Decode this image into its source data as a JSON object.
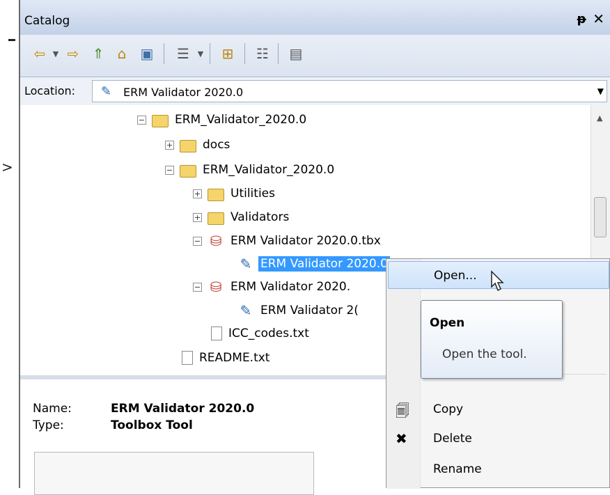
{
  "window": {
    "title": "Catalog",
    "pin_glyph": "ᵽ",
    "close_glyph": "✕"
  },
  "toolbar": {
    "buttons": [
      {
        "name": "back-button",
        "icon": "back-arrow-icon",
        "glyph": "⇦"
      },
      {
        "name": "back-dropdown",
        "icon": "dropdown-icon",
        "glyph": "▼"
      },
      {
        "name": "forward-button",
        "icon": "forward-arrow-icon",
        "glyph": "⇨"
      },
      {
        "name": "up-level-button",
        "icon": "up-folder-icon",
        "glyph": "⇑"
      },
      {
        "name": "home-button",
        "icon": "home-icon",
        "glyph": "⌂"
      },
      {
        "name": "connect-button",
        "icon": "connect-folder-icon",
        "glyph": "▣"
      },
      {
        "name": "view-button",
        "icon": "view-details-icon",
        "glyph": "☰"
      },
      {
        "name": "view-dropdown",
        "icon": "dropdown-icon",
        "glyph": "▼"
      },
      {
        "name": "new-folder-button",
        "icon": "new-folder-icon",
        "glyph": "⊞"
      },
      {
        "name": "tree-view-button",
        "icon": "tree-view-icon",
        "glyph": "☷"
      },
      {
        "name": "options-button",
        "icon": "list-options-icon",
        "glyph": "▤"
      }
    ]
  },
  "location": {
    "label": "Location:",
    "value": "ERM Validator 2020.0",
    "dropdown_glyph": "▼",
    "icon_glyph": "✎"
  },
  "tree": {
    "expand_glyph": "⊞",
    "collapse_glyph": "⊟",
    "nodes": [
      {
        "label": "ERM_Validator_2020.0",
        "type": "folder",
        "expander": "−"
      },
      {
        "label": "docs",
        "type": "folder",
        "expander": "+"
      },
      {
        "label": "ERM_Validator_2020.0",
        "type": "folder",
        "expander": "−"
      },
      {
        "label": "Utilities",
        "type": "folder",
        "expander": "+"
      },
      {
        "label": "Validators",
        "type": "folder",
        "expander": "+"
      },
      {
        "label": "ERM Validator 2020.0.tbx",
        "type": "toolbox",
        "expander": "−"
      },
      {
        "label": "ERM Validator 2020.0",
        "type": "tool",
        "expander": "",
        "selected": true
      },
      {
        "label": "ERM Validator 2020.",
        "type": "toolbox",
        "expander": "−"
      },
      {
        "label": "ERM Validator 2(",
        "type": "tool",
        "expander": ""
      },
      {
        "label": "ICC_codes.txt",
        "type": "text",
        "expander": ""
      },
      {
        "label": "README.txt",
        "type": "text",
        "expander": ""
      }
    ]
  },
  "details": {
    "name_key": "Name:",
    "name_value": "ERM Validator 2020.0",
    "type_key": "Type:",
    "type_value": "Toolbox Tool"
  },
  "context_menu": {
    "items": [
      {
        "label": "Open...",
        "icon": "",
        "highlighted": true
      },
      {
        "label": "Copy",
        "icon": "copy-icon",
        "glyph": "🗐"
      },
      {
        "label": "Delete",
        "icon": "delete-icon",
        "glyph": "✖"
      },
      {
        "label": "Rename",
        "icon": ""
      }
    ]
  },
  "tooltip": {
    "title": "Open",
    "body": "Open the tool."
  },
  "colors": {
    "selection": "#3399ff",
    "title_bar": "#c3d2e8",
    "menu_highlight": "#cfe3fb"
  }
}
